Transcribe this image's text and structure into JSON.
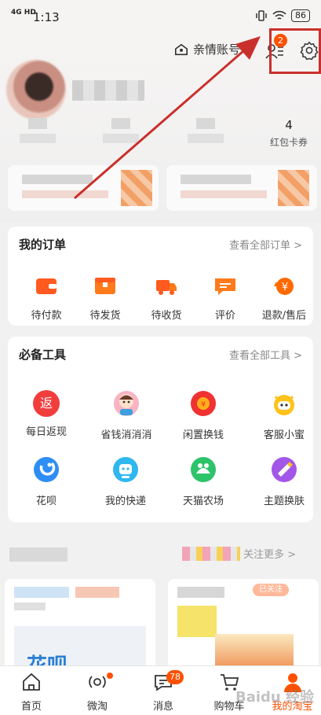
{
  "status": {
    "time": "1:13",
    "network": "4G HD",
    "battery": "86"
  },
  "header": {
    "family_account": "亲情账号",
    "message_badge": "2",
    "stats": [
      {
        "value": "4",
        "label": "红包卡券"
      }
    ],
    "icons": [
      "family-icon",
      "message-list-icon",
      "settings-gear-icon"
    ]
  },
  "orders": {
    "title": "我的订单",
    "link": "查看全部订单 >",
    "items": [
      {
        "label": "待付款",
        "icon": "wallet-icon",
        "color": "#ff5a1f"
      },
      {
        "label": "待发货",
        "icon": "package-icon",
        "color": "#ff7a1a"
      },
      {
        "label": "待收货",
        "icon": "truck-icon",
        "color": "#ff5a1f"
      },
      {
        "label": "评价",
        "icon": "comment-icon",
        "color": "#ff7a1a"
      },
      {
        "label": "退款/售后",
        "icon": "refund-icon",
        "color": "#ff6a00"
      }
    ]
  },
  "tools": {
    "title": "必备工具",
    "link": "查看全部工具 >",
    "items": [
      {
        "label": "每日返现",
        "icon": "cashback-icon",
        "glyph": "返",
        "color": "#f23d3d"
      },
      {
        "label": "省钱消消消",
        "icon": "game-avatar-icon",
        "glyph": "",
        "color": "#f8b3c4"
      },
      {
        "label": "闲置换钱",
        "icon": "idle-money-icon",
        "glyph": "¥",
        "color": "#f03232"
      },
      {
        "label": "客服小蜜",
        "icon": "service-bot-icon",
        "glyph": "",
        "color": "#ffc21a"
      },
      {
        "label": "花呗",
        "icon": "huabei-icon",
        "glyph": "",
        "color": "#2f8ef5"
      },
      {
        "label": "我的快递",
        "icon": "express-icon",
        "glyph": "",
        "color": "#2fb7f0"
      },
      {
        "label": "天猫农场",
        "icon": "farm-icon",
        "glyph": "",
        "color": "#2dc36a"
      },
      {
        "label": "主题换肤",
        "icon": "theme-icon",
        "glyph": "",
        "color": "#a257e8"
      }
    ]
  },
  "feed": {
    "follow_more": "关注更多 >",
    "card_tag": "已关注",
    "card_text": "花呗"
  },
  "tabbar": {
    "tabs": [
      {
        "label": "首页",
        "icon": "home-icon"
      },
      {
        "label": "微淘",
        "icon": "weitao-icon",
        "dot": true
      },
      {
        "label": "消息",
        "icon": "message-icon",
        "badge": "78"
      },
      {
        "label": "购物车",
        "icon": "cart-icon"
      },
      {
        "label": "我的淘宝",
        "icon": "my-taobao-icon",
        "active": true
      }
    ]
  },
  "watermark": "Baidu 经验",
  "accent": "#ff5000",
  "annotation_color": "#c9302c"
}
